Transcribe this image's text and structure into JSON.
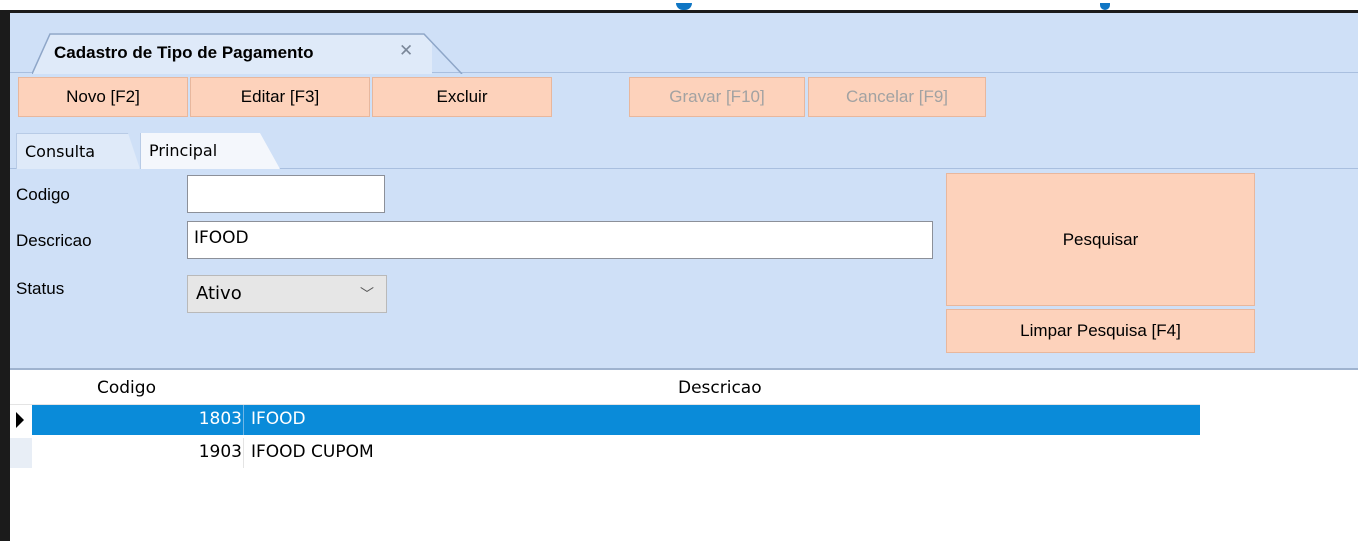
{
  "document_tab": {
    "title": "Cadastro de Tipo de Pagamento",
    "close": "✕"
  },
  "toolbar": {
    "novo": "Novo [F2]",
    "editar": "Editar [F3]",
    "excluir": "Excluir",
    "gravar": "Gravar [F10]",
    "cancelar": "Cancelar [F9]"
  },
  "tabs": {
    "consulta": "Consulta",
    "principal": "Principal"
  },
  "form": {
    "codigo_label": "Codigo",
    "codigo_value": "",
    "descricao_label": "Descricao",
    "descricao_value": "IFOOD",
    "status_label": "Status",
    "status_value": "Ativo"
  },
  "actions": {
    "pesquisar": "Pesquisar",
    "limpar": "Limpar Pesquisa [F4]"
  },
  "grid": {
    "columns": [
      "Codigo",
      "Descricao"
    ],
    "rows": [
      {
        "codigo": "1803",
        "descricao": "IFOOD",
        "selected": true
      },
      {
        "codigo": "1903",
        "descricao": "IFOOD CUPOM",
        "selected": false
      }
    ]
  },
  "colors": {
    "toolbar_button": "#fdd2bb",
    "panel": "#cfe0f7",
    "selection": "#0a8bd9"
  }
}
